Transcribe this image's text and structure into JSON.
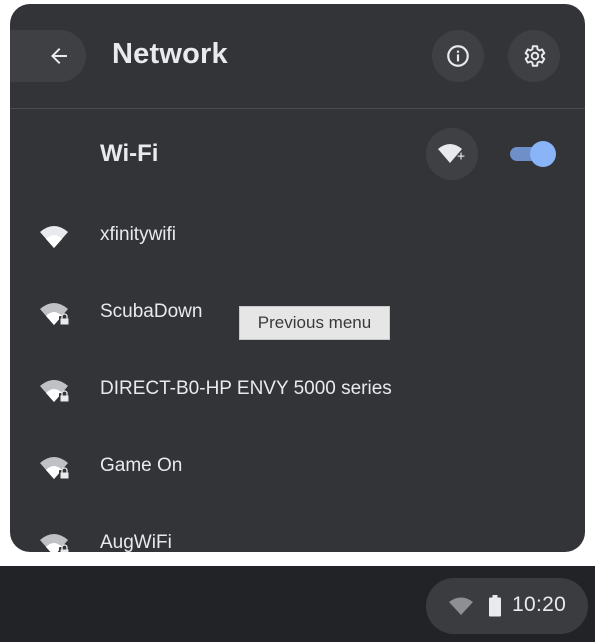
{
  "header": {
    "back_icon": "arrow-back-icon",
    "title": "Network",
    "info_icon": "info-icon",
    "settings_icon": "gear-icon"
  },
  "wifi": {
    "label": "Wi-Fi",
    "add_network_icon": "wifi-add-icon",
    "enabled": true,
    "toggle_color": "#8ab4f8"
  },
  "networks": [
    {
      "name": "xfinitywifi",
      "secured": false
    },
    {
      "name": "ScubaDown",
      "secured": true
    },
    {
      "name": "DIRECT-B0-HP ENVY 5000 series",
      "secured": true
    },
    {
      "name": "Game On",
      "secured": true
    },
    {
      "name": "AugWiFi",
      "secured": true
    }
  ],
  "tooltip": {
    "text": "Previous menu"
  },
  "shelf": {
    "time": "10:20",
    "wifi_icon": "wifi-icon",
    "battery_icon": "battery-icon"
  },
  "colors": {
    "panel_bg": "#333437",
    "button_bg": "#3f4043",
    "text": "#e8eaed",
    "accent": "#8ab4f8",
    "shelf_bg": "#222327"
  }
}
